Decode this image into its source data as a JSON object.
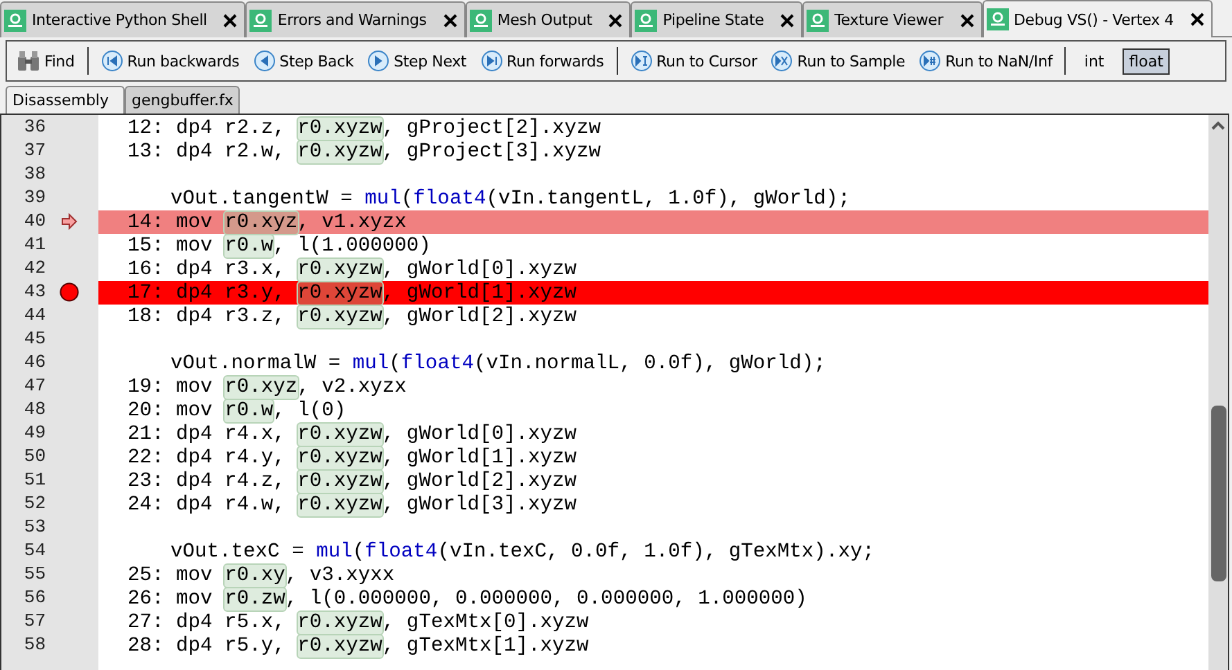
{
  "tabs": [
    {
      "label": "Interactive Python Shell",
      "selected": false
    },
    {
      "label": "Errors and Warnings",
      "selected": false
    },
    {
      "label": "Mesh Output",
      "selected": false
    },
    {
      "label": "Pipeline State",
      "selected": false
    },
    {
      "label": "Texture Viewer",
      "selected": false
    },
    {
      "label": "Debug VS() - Vertex 4",
      "selected": true
    }
  ],
  "toolbar": {
    "find": "Find",
    "buttons": [
      {
        "label": "Run backwards",
        "kind": "run-back"
      },
      {
        "label": "Step Back",
        "kind": "step-back"
      },
      {
        "label": "Step Next",
        "kind": "step-next"
      },
      {
        "label": "Run forwards",
        "kind": "run-fwd"
      },
      {
        "label": "Run to Cursor",
        "kind": "cursor",
        "group_start": true
      },
      {
        "label": "Run to Sample",
        "kind": "sample"
      },
      {
        "label": "Run to NaN/Inf",
        "kind": "nan"
      }
    ],
    "modes": [
      {
        "label": "int",
        "selected": false
      },
      {
        "label": "float",
        "selected": true
      }
    ]
  },
  "editor_tabs": [
    {
      "label": "Disassembly",
      "selected": true
    },
    {
      "label": "gengbuffer.fx",
      "selected": false
    }
  ],
  "lines": [
    {
      "number": "36",
      "kind": "asm",
      "tokens": [
        {
          "text": "12: dp4 r2.z, ",
          "kind": "plain"
        },
        {
          "text": "r0.xyzw",
          "kind": "reg"
        },
        {
          "text": ", gProject[2].xyzw",
          "kind": "plain"
        }
      ]
    },
    {
      "number": "37",
      "kind": "asm",
      "tokens": [
        {
          "text": "13: dp4 r2.w, ",
          "kind": "plain"
        },
        {
          "text": "r0.xyzw",
          "kind": "reg"
        },
        {
          "text": ", gProject[3].xyzw",
          "kind": "plain"
        }
      ]
    },
    {
      "number": "38",
      "kind": "blank"
    },
    {
      "number": "39",
      "kind": "source",
      "tokens": [
        {
          "text": "vOut.tangentW = ",
          "kind": "plain"
        },
        {
          "text": "mul",
          "kind": "kw"
        },
        {
          "text": "(",
          "kind": "plain"
        },
        {
          "text": "float4",
          "kind": "kw"
        },
        {
          "text": "(vIn.tangentL, 1.0f), gWorld);",
          "kind": "plain"
        }
      ]
    },
    {
      "number": "40",
      "kind": "asm",
      "current": true,
      "tokens": [
        {
          "text": "14: mov ",
          "kind": "plain"
        },
        {
          "text": "r0.xyz",
          "kind": "reg"
        },
        {
          "text": ", v1.xyzx",
          "kind": "plain"
        }
      ]
    },
    {
      "number": "41",
      "kind": "asm",
      "tokens": [
        {
          "text": "15: mov ",
          "kind": "plain"
        },
        {
          "text": "r0.w",
          "kind": "reg"
        },
        {
          "text": ", l(1.000000)",
          "kind": "plain"
        }
      ]
    },
    {
      "number": "42",
      "kind": "asm",
      "tokens": [
        {
          "text": "16: dp4 r3.x, ",
          "kind": "plain"
        },
        {
          "text": "r0.xyzw",
          "kind": "reg"
        },
        {
          "text": ", gWorld[0].xyzw",
          "kind": "plain"
        }
      ]
    },
    {
      "number": "43",
      "kind": "asm",
      "breakpoint": true,
      "tokens": [
        {
          "text": "17: dp4 r3.y, ",
          "kind": "plain"
        },
        {
          "text": "r0.xyzw",
          "kind": "reg"
        },
        {
          "text": ", gWorld[1].xyzw",
          "kind": "plain"
        }
      ]
    },
    {
      "number": "44",
      "kind": "asm",
      "tokens": [
        {
          "text": "18: dp4 r3.z, ",
          "kind": "plain"
        },
        {
          "text": "r0.xyzw",
          "kind": "reg"
        },
        {
          "text": ", gWorld[2].xyzw",
          "kind": "plain"
        }
      ]
    },
    {
      "number": "45",
      "kind": "blank"
    },
    {
      "number": "46",
      "kind": "source",
      "tokens": [
        {
          "text": "vOut.normalW = ",
          "kind": "plain"
        },
        {
          "text": "mul",
          "kind": "kw"
        },
        {
          "text": "(",
          "kind": "plain"
        },
        {
          "text": "float4",
          "kind": "kw"
        },
        {
          "text": "(vIn.normalL, 0.0f), gWorld);",
          "kind": "plain"
        }
      ]
    },
    {
      "number": "47",
      "kind": "asm",
      "tokens": [
        {
          "text": "19: mov ",
          "kind": "plain"
        },
        {
          "text": "r0.xyz",
          "kind": "reg"
        },
        {
          "text": ", v2.xyzx",
          "kind": "plain"
        }
      ]
    },
    {
      "number": "48",
      "kind": "asm",
      "tokens": [
        {
          "text": "20: mov ",
          "kind": "plain"
        },
        {
          "text": "r0.w",
          "kind": "reg"
        },
        {
          "text": ", l(0)",
          "kind": "plain"
        }
      ]
    },
    {
      "number": "49",
      "kind": "asm",
      "tokens": [
        {
          "text": "21: dp4 r4.x, ",
          "kind": "plain"
        },
        {
          "text": "r0.xyzw",
          "kind": "reg"
        },
        {
          "text": ", gWorld[0].xyzw",
          "kind": "plain"
        }
      ]
    },
    {
      "number": "50",
      "kind": "asm",
      "tokens": [
        {
          "text": "22: dp4 r4.y, ",
          "kind": "plain"
        },
        {
          "text": "r0.xyzw",
          "kind": "reg"
        },
        {
          "text": ", gWorld[1].xyzw",
          "kind": "plain"
        }
      ]
    },
    {
      "number": "51",
      "kind": "asm",
      "tokens": [
        {
          "text": "23: dp4 r4.z, ",
          "kind": "plain"
        },
        {
          "text": "r0.xyzw",
          "kind": "reg"
        },
        {
          "text": ", gWorld[2].xyzw",
          "kind": "plain"
        }
      ]
    },
    {
      "number": "52",
      "kind": "asm",
      "tokens": [
        {
          "text": "24: dp4 r4.w, ",
          "kind": "plain"
        },
        {
          "text": "r0.xyzw",
          "kind": "reg"
        },
        {
          "text": ", gWorld[3].xyzw",
          "kind": "plain"
        }
      ]
    },
    {
      "number": "53",
      "kind": "blank"
    },
    {
      "number": "54",
      "kind": "source",
      "tokens": [
        {
          "text": "vOut.texC = ",
          "kind": "plain"
        },
        {
          "text": "mul",
          "kind": "kw"
        },
        {
          "text": "(",
          "kind": "plain"
        },
        {
          "text": "float4",
          "kind": "kw"
        },
        {
          "text": "(vIn.texC, 0.0f, 1.0f), gTexMtx).xy;",
          "kind": "plain"
        }
      ]
    },
    {
      "number": "55",
      "kind": "asm",
      "tokens": [
        {
          "text": "25: mov ",
          "kind": "plain"
        },
        {
          "text": "r0.xy",
          "kind": "reg"
        },
        {
          "text": ", v3.xyxx",
          "kind": "plain"
        }
      ]
    },
    {
      "number": "56",
      "kind": "asm",
      "tokens": [
        {
          "text": "26: mov ",
          "kind": "plain"
        },
        {
          "text": "r0.zw",
          "kind": "reg"
        },
        {
          "text": ", l(0.000000, 0.000000, 0.000000, 1.000000)",
          "kind": "plain"
        }
      ]
    },
    {
      "number": "57",
      "kind": "asm",
      "tokens": [
        {
          "text": "27: dp4 r5.x, ",
          "kind": "plain"
        },
        {
          "text": "r0.xyzw",
          "kind": "reg"
        },
        {
          "text": ", gTexMtx[0].xyzw",
          "kind": "plain"
        }
      ]
    },
    {
      "number": "58",
      "kind": "asm",
      "tokens": [
        {
          "text": "28: dp4 r5.y, ",
          "kind": "plain"
        },
        {
          "text": "r0.xyzw",
          "kind": "reg"
        },
        {
          "text": ", gTexMtx[1].xyzw",
          "kind": "plain"
        }
      ]
    }
  ]
}
